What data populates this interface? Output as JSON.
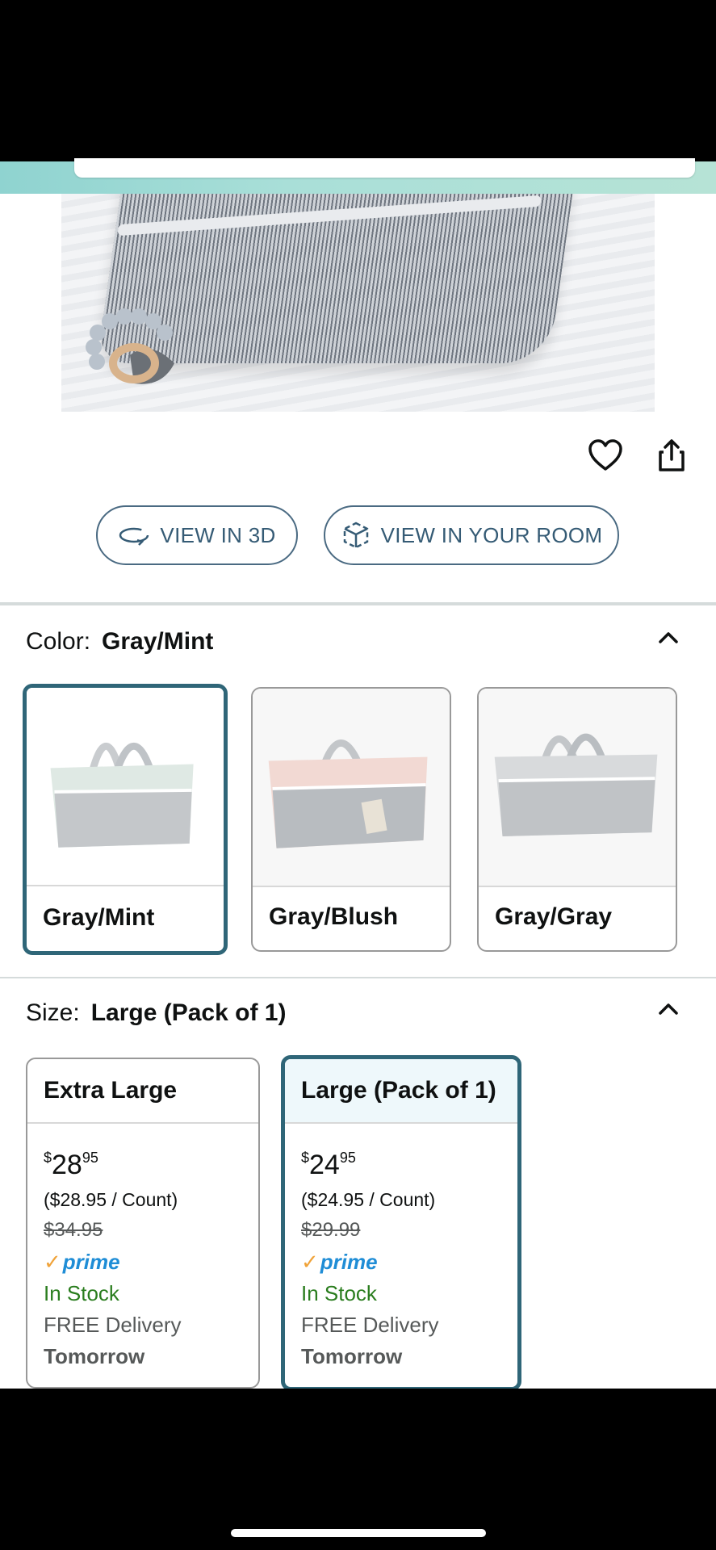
{
  "actions": {
    "heart_icon": "heart-outline-icon",
    "share_icon": "share-icon"
  },
  "ar_buttons": {
    "view_3d": "VIEW IN 3D",
    "view_room": "VIEW IN YOUR ROOM"
  },
  "color": {
    "label": "Color:",
    "selected": "Gray/Mint",
    "options": [
      {
        "name": "Gray/Mint"
      },
      {
        "name": "Gray/Blush"
      },
      {
        "name": "Gray/Gray"
      }
    ]
  },
  "size": {
    "label": "Size:",
    "selected": "Large (Pack of 1)",
    "options": [
      {
        "name": "Extra Large",
        "price_whole": "28",
        "price_frac": "95",
        "currency": "$",
        "unit_price": "($28.95 / Count)",
        "list_price": "$34.95",
        "prime": "prime",
        "stock": "In Stock",
        "delivery": "FREE Delivery",
        "when": "Tomorrow"
      },
      {
        "name": "Large (Pack of 1)",
        "price_whole": "24",
        "price_frac": "95",
        "currency": "$",
        "unit_price": "($24.95 / Count)",
        "list_price": "$29.99",
        "prime": "prime",
        "stock": "In Stock",
        "delivery": "FREE Delivery",
        "when": "Tomorrow"
      }
    ]
  },
  "colors": {
    "accent": "#2f6678",
    "link": "#355b75",
    "in_stock": "#2a7d1e",
    "prime_blue": "#1f8dd6",
    "prime_check": "#f0a33a"
  }
}
